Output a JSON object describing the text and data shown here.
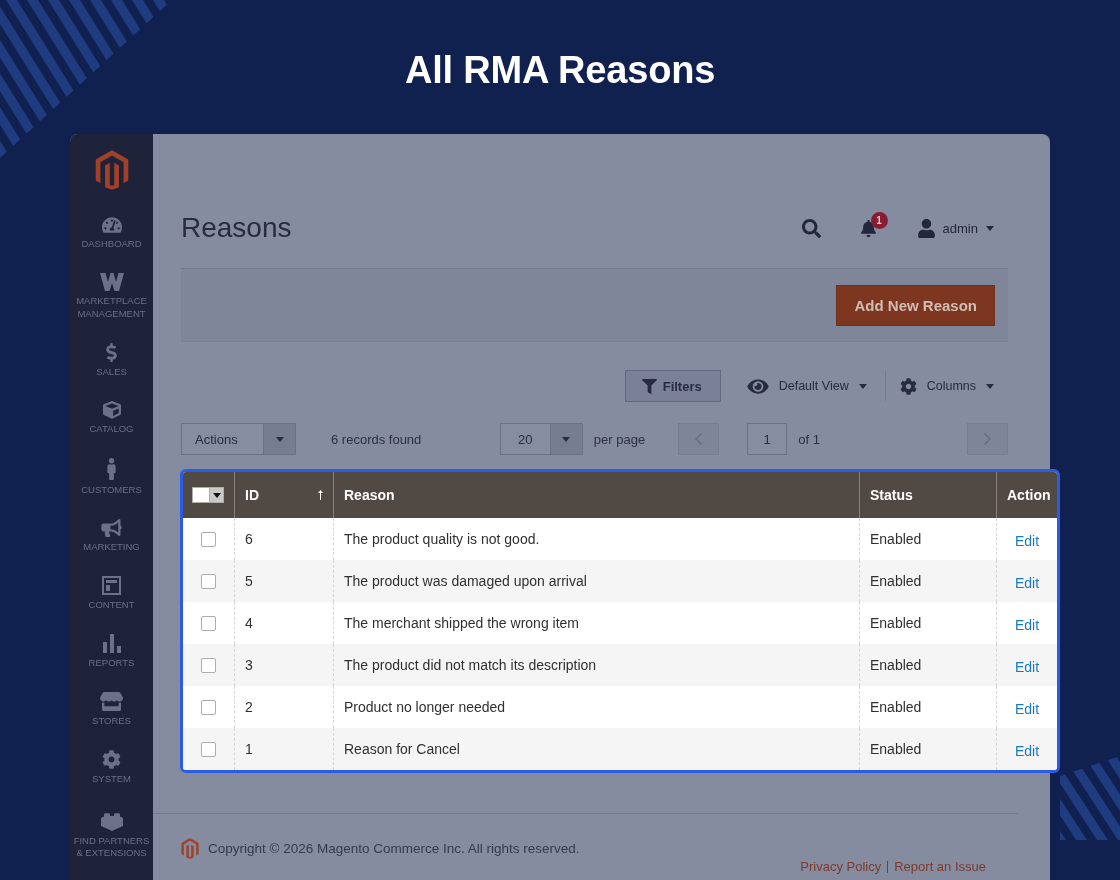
{
  "banner": {
    "title": "All RMA Reasons"
  },
  "sidebar": {
    "items": [
      {
        "label": "DASHBOARD"
      },
      {
        "label": "MARKETPLACE MANAGEMENT"
      },
      {
        "label": "SALES"
      },
      {
        "label": "CATALOG"
      },
      {
        "label": "CUSTOMERS"
      },
      {
        "label": "MARKETING"
      },
      {
        "label": "CONTENT"
      },
      {
        "label": "REPORTS"
      },
      {
        "label": "STORES"
      },
      {
        "label": "SYSTEM"
      },
      {
        "label": "FIND PARTNERS & EXTENSIONS"
      }
    ]
  },
  "page": {
    "title": "Reasons",
    "notifications": "1",
    "user": "admin",
    "add_button": "Add New Reason"
  },
  "toolbar": {
    "filters": "Filters",
    "view": "Default View",
    "columns": "Columns"
  },
  "grid_controls": {
    "actions": "Actions",
    "records_found": "6 records found",
    "per_page": "20",
    "per_page_label": "per page",
    "page": "1",
    "page_total": "of 1"
  },
  "table": {
    "select_all": {
      "checked": false
    },
    "columns": [
      {
        "label": "ID",
        "sorted": true
      },
      {
        "label": "Reason",
        "sorted": false
      },
      {
        "label": "Status",
        "sorted": false
      },
      {
        "label": "Action",
        "sorted": false
      }
    ],
    "rows": [
      {
        "checked": false,
        "id": "6",
        "reason": "The product quality is not good.",
        "status": "Enabled",
        "action": "Edit"
      },
      {
        "checked": false,
        "id": "5",
        "reason": "The product was damaged upon arrival",
        "status": "Enabled",
        "action": "Edit"
      },
      {
        "checked": false,
        "id": "4",
        "reason": "The merchant shipped the wrong item",
        "status": "Enabled",
        "action": "Edit"
      },
      {
        "checked": false,
        "id": "3",
        "reason": "The product did not match its description",
        "status": "Enabled",
        "action": "Edit"
      },
      {
        "checked": false,
        "id": "2",
        "reason": "Product no longer needed",
        "status": "Enabled",
        "action": "Edit"
      },
      {
        "checked": false,
        "id": "1",
        "reason": "Reason for Cancel",
        "status": "Enabled",
        "action": "Edit"
      }
    ]
  },
  "footer": {
    "copyright": "Copyright © 2026 Magento Commerce Inc. All rights reserved.",
    "links": [
      "Privacy Policy",
      "Report an Issue"
    ]
  }
}
